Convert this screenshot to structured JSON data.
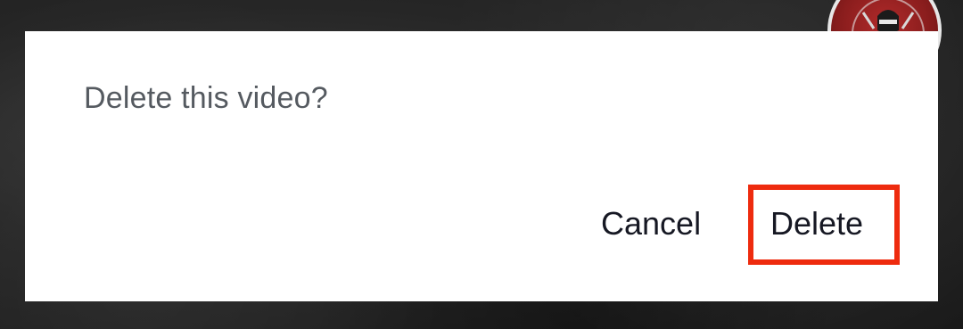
{
  "dialog": {
    "message": "Delete this video?",
    "cancel_label": "Cancel",
    "delete_label": "Delete"
  },
  "colors": {
    "highlight": "#ee2b0e",
    "dialog_background": "#ffffff",
    "message_text": "#555a60",
    "button_text": "#161823",
    "avatar_fill": "#8a1d1d"
  },
  "icons": {
    "avatar": "profile-avatar"
  }
}
